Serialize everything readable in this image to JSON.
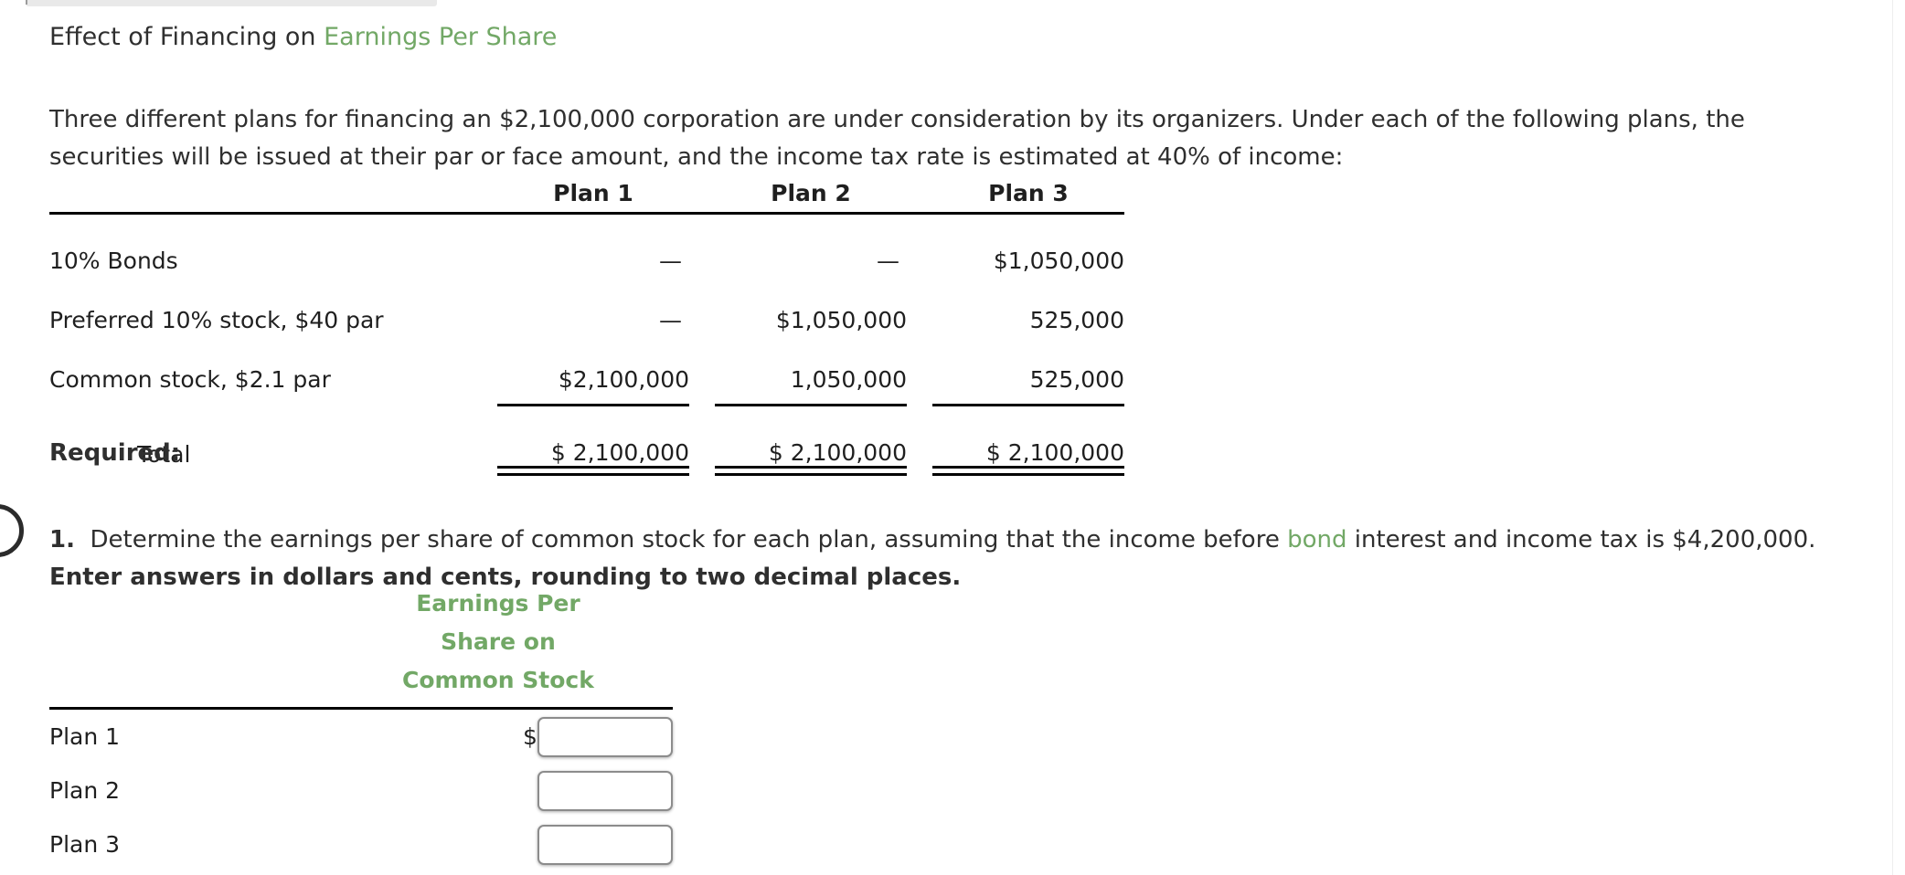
{
  "heading": {
    "plain_part": "Effect of Financing on ",
    "accent_part": "Earnings Per Share"
  },
  "intro": {
    "text": "Three different plans for financing an $2,100,000 corporation are under consideration by its organizers. Under each of the following plans, the securities will be issued at their par or face amount, and the income tax rate is estimated at 40% of income:"
  },
  "securities_table": {
    "columns": [
      "",
      "Plan 1",
      "Plan 2",
      "Plan 3"
    ],
    "rows": [
      {
        "label": "10% Bonds",
        "plan1": "—",
        "plan2": "—",
        "plan3": "$1,050,000"
      },
      {
        "label": "Preferred 10% stock, $40 par",
        "plan1": "—",
        "plan2": "$1,050,000",
        "plan3": "525,000"
      },
      {
        "label": "Common stock, $2.1 par",
        "plan1": "$2,100,000",
        "plan2": "1,050,000",
        "plan3": "525,000"
      }
    ],
    "total": {
      "label": "Total",
      "plan1": "$ 2,100,000",
      "plan2": "$ 2,100,000",
      "plan3": "$ 2,100,000"
    }
  },
  "required": {
    "heading": "Required:",
    "item1": {
      "number": "1.",
      "part_a": "Determine the earnings per share of common stock for each plan, assuming that the income before ",
      "accent_word": "bond",
      "part_b": " interest and income tax is $4,200,000. ",
      "bold_part": "Enter answers in dollars and cents, rounding to two decimal places."
    }
  },
  "answer_table": {
    "header_lines": [
      "Earnings Per",
      "Share on",
      "Common Stock"
    ],
    "rows": [
      {
        "label": "Plan 1",
        "currency": "$",
        "value": "",
        "placeholder": ""
      },
      {
        "label": "Plan 2",
        "currency": "",
        "value": "",
        "placeholder": ""
      },
      {
        "label": "Plan 3",
        "currency": "",
        "value": "",
        "placeholder": ""
      }
    ]
  },
  "colors": {
    "accent_green": "#72a866",
    "text": "#2f2f2f",
    "rule": "#000000",
    "input_border": "#8c8c8c"
  }
}
